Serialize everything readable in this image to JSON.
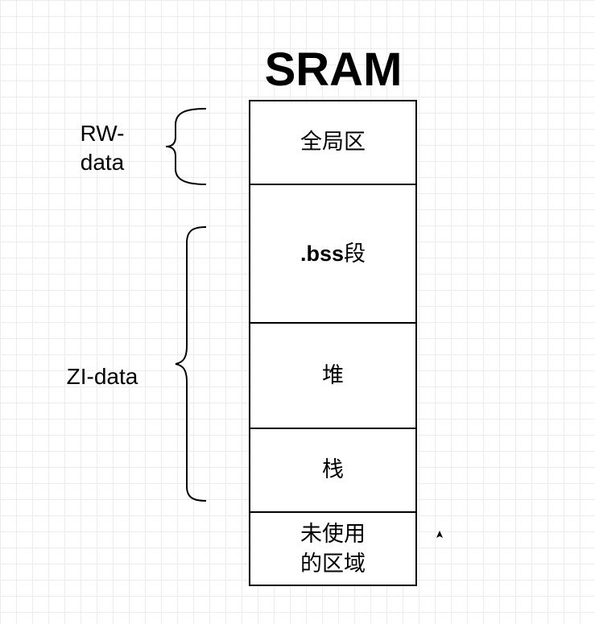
{
  "diagram": {
    "title": "SRAM",
    "blocks": {
      "global": {
        "label": "全局区"
      },
      "bss": {
        "label_prefix": ".bss",
        "label_suffix": "段"
      },
      "heap": {
        "label": "堆"
      },
      "stack": {
        "label": "栈"
      },
      "unused": {
        "label": "未使用\n的区域"
      }
    },
    "groups": {
      "rw": {
        "label": "RW-\ndata"
      },
      "zi": {
        "label": "ZI-data"
      }
    }
  }
}
